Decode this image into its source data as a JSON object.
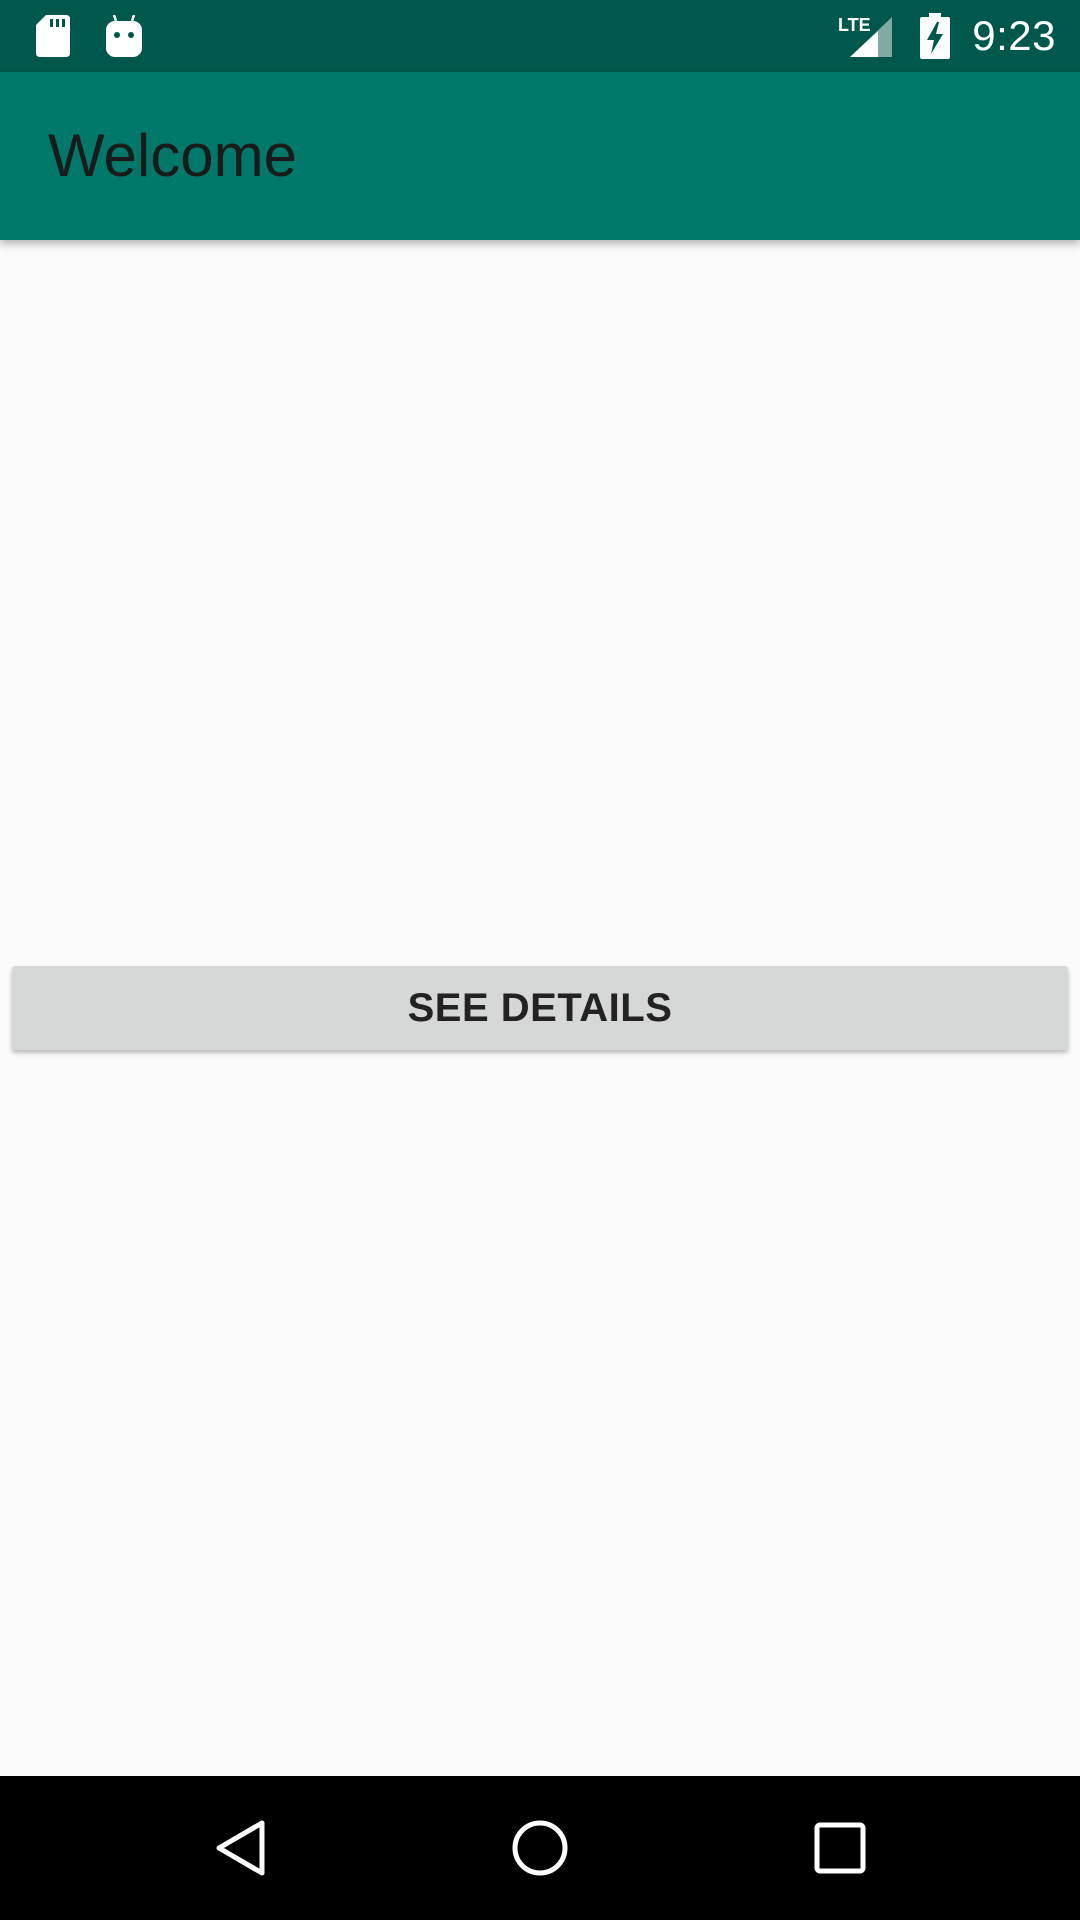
{
  "status_bar": {
    "time": "9:23",
    "network_label": "LTE",
    "icons": [
      "sd-card-icon",
      "android-icon",
      "lte-signal-icon",
      "battery-charging-icon"
    ]
  },
  "app_bar": {
    "title": "Welcome"
  },
  "main": {
    "details_button_label": "SEE DETAILS"
  },
  "nav_bar": {
    "icons": [
      "back-icon",
      "home-icon",
      "recents-icon"
    ]
  },
  "colors": {
    "status_bar": "#00574b",
    "app_bar": "#00796b",
    "background": "#fafafa",
    "button": "#d6d7d7",
    "nav_bar": "#000000"
  }
}
